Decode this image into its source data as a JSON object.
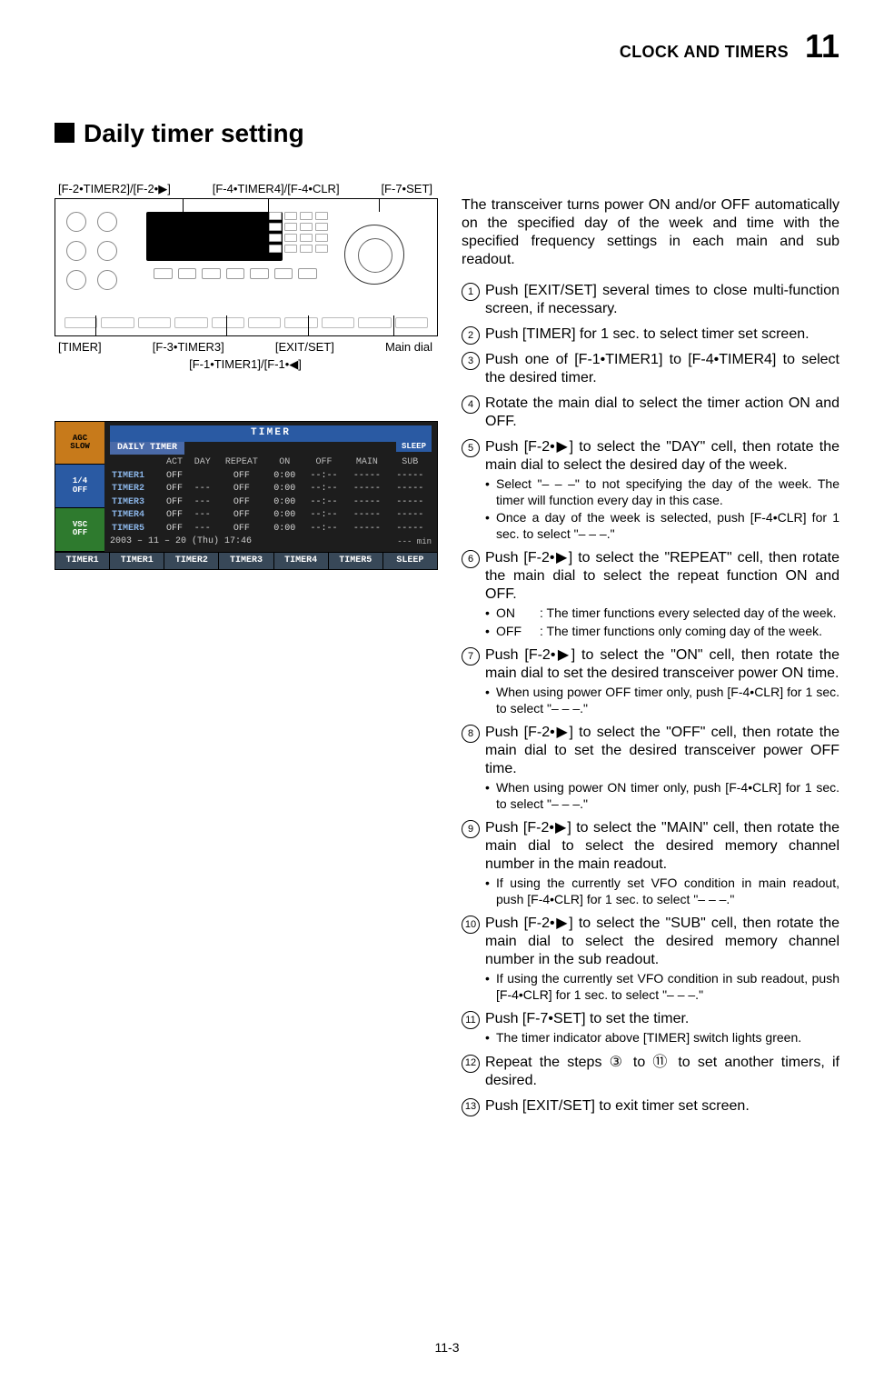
{
  "header": {
    "chapter_title": "CLOCK AND TIMERS",
    "chapter_number": "11"
  },
  "section": {
    "title": "Daily timer setting"
  },
  "figure": {
    "top_labels": {
      "f2": "[F-2•TIMER2]/[F-2•▶]",
      "f4": "[F-4•TIMER4]/[F-4•CLR]",
      "f7": "[F-7•SET]"
    },
    "bottom_labels": {
      "timer": "[TIMER]",
      "f3": "[F-3•TIMER3]",
      "exit": "[EXIT/SET]",
      "main_dial": "Main dial",
      "f1": "[F-1•TIMER1]/[F-1•◀]"
    }
  },
  "lcd": {
    "titlebar": "TIMER",
    "sidebar": {
      "agc_top": "AGC",
      "agc_bot": "SLOW",
      "q_top": "1/4",
      "q_bot": "OFF",
      "vsc_top": "VSC",
      "vsc_bot": "OFF",
      "timer1": "TIMER1"
    },
    "heading": "DAILY  TIMER",
    "columns": [
      "",
      "ACT",
      "DAY",
      "REPEAT",
      "ON",
      "OFF",
      "MAIN",
      "SUB"
    ],
    "rows": [
      {
        "name": "TIMER1",
        "act": "OFF",
        "day": "",
        "repeat": "OFF",
        "on": "0:00",
        "off": "--:--",
        "main": "-----",
        "sub": "-----"
      },
      {
        "name": "TIMER2",
        "act": "OFF",
        "day": "---",
        "repeat": "OFF",
        "on": "0:00",
        "off": "--:--",
        "main": "-----",
        "sub": "-----"
      },
      {
        "name": "TIMER3",
        "act": "OFF",
        "day": "---",
        "repeat": "OFF",
        "on": "0:00",
        "off": "--:--",
        "main": "-----",
        "sub": "-----"
      },
      {
        "name": "TIMER4",
        "act": "OFF",
        "day": "---",
        "repeat": "OFF",
        "on": "0:00",
        "off": "--:--",
        "main": "-----",
        "sub": "-----"
      },
      {
        "name": "TIMER5",
        "act": "OFF",
        "day": "---",
        "repeat": "OFF",
        "on": "0:00",
        "off": "--:--",
        "main": "-----",
        "sub": "-----"
      }
    ],
    "datebar": "2003 – 11 – 20 (Thu)   17:46",
    "sleep_label": "SLEEP",
    "sleep_value": "---  min",
    "softkeys": [
      "TIMER1",
      "TIMER2",
      "TIMER3",
      "TIMER4",
      "TIMER5",
      "SLEEP"
    ]
  },
  "intro": "The transceiver turns power ON and/or OFF automatically on the specified day of the week and time with the specified frequency settings in each main and sub readout.",
  "steps": [
    {
      "n": "1",
      "text": "Push [EXIT/SET] several times to close multi-function screen, if necessary."
    },
    {
      "n": "2",
      "text": "Push [TIMER] for 1 sec. to select timer set screen."
    },
    {
      "n": "3",
      "text": "Push one of [F-1•TIMER1] to [F-4•TIMER4] to select the desired timer."
    },
    {
      "n": "4",
      "text": "Rotate the main dial to select the timer action ON and OFF."
    },
    {
      "n": "5",
      "text": "Push [F-2•▶] to select the \"DAY\" cell, then rotate the main dial to select the desired day of the week.",
      "sub": [
        "Select \"– – –\" to not specifying the day of the week. The timer will function every day in this case.",
        "Once a day of the week is selected, push [F-4•CLR] for 1 sec. to select \"– – –.\""
      ]
    },
    {
      "n": "6",
      "text": "Push [F-2•▶] to select the \"REPEAT\" cell, then rotate the main dial to select the repeat function ON and OFF.",
      "onoff": [
        {
          "label": "ON",
          "text": ": The timer functions every selected day of the week."
        },
        {
          "label": "OFF",
          "text": ": The timer functions only coming day of the week."
        }
      ]
    },
    {
      "n": "7",
      "text": "Push [F-2•▶] to select the \"ON\" cell, then rotate the main dial to set the desired transceiver power ON time.",
      "sub": [
        "When using power OFF timer only, push [F-4•CLR] for 1 sec. to select \"– – –.\""
      ]
    },
    {
      "n": "8",
      "text": "Push [F-2•▶] to select the \"OFF\" cell, then rotate the main dial to set the desired transceiver power OFF time.",
      "sub": [
        "When using power ON timer only, push [F-4•CLR] for 1 sec. to select \"– – –.\""
      ]
    },
    {
      "n": "9",
      "text": "Push [F-2•▶] to select the \"MAIN\" cell, then rotate the main dial to select the desired memory channel number in the main readout.",
      "sub": [
        "If using the currently set VFO condition in main readout, push [F-4•CLR] for 1 sec. to select \"– – –.\""
      ]
    },
    {
      "n": "10",
      "text": "Push [F-2•▶] to select the \"SUB\" cell, then rotate the main dial to select the desired memory channel number in the sub readout.",
      "sub": [
        "If using the currently set VFO condition in sub readout, push [F-4•CLR] for 1 sec. to select \"– – –.\""
      ]
    },
    {
      "n": "11",
      "text": "Push [F-7•SET] to set the timer.",
      "sub": [
        "The timer indicator above [TIMER] switch lights green."
      ]
    },
    {
      "n": "12",
      "text": "Repeat the steps ③ to ⑪ to set another timers, if desired."
    },
    {
      "n": "13",
      "text": "Push [EXIT/SET] to exit timer set screen."
    }
  ],
  "footer": "11-3"
}
